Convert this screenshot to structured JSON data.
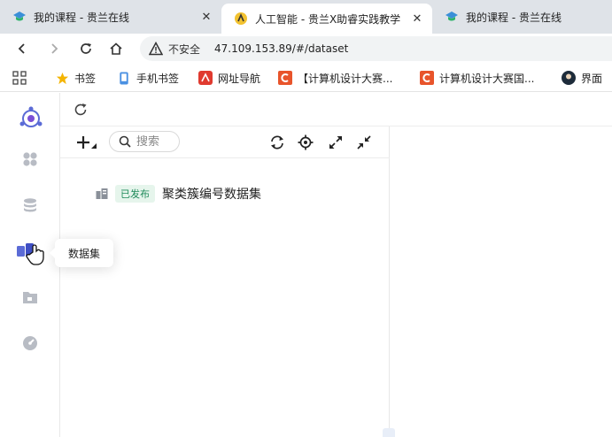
{
  "browser": {
    "tabs": [
      {
        "title": "我的课程 - 贵兰在线",
        "icon": "graduation-cap-icon",
        "active": false
      },
      {
        "title": "人工智能 - 贵兰X助睿实践教学",
        "icon": "ai-logo-icon",
        "active": true
      },
      {
        "title": "我的课程 - 贵兰在线",
        "icon": "graduation-cap-icon",
        "active": false
      }
    ],
    "close_glyph": "✕",
    "address": {
      "security_label": "不安全",
      "url": "47.109.153.89/#/dataset"
    },
    "bookmarks": [
      {
        "label": "书签",
        "icon": "star-icon"
      },
      {
        "label": "手机书签",
        "icon": "phone-icon"
      },
      {
        "label": "网址导航",
        "icon": "nav-logo-icon"
      },
      {
        "label": "【计算机设计大赛...",
        "icon": "c-logo-icon"
      },
      {
        "label": "计算机设计大赛国...",
        "icon": "c-logo-icon"
      },
      {
        "label": "界面",
        "icon": "avatar-icon"
      }
    ]
  },
  "app": {
    "sidebar": {
      "items": [
        {
          "name": "apps",
          "icon": "grid-icon"
        },
        {
          "name": "database",
          "icon": "database-icon"
        },
        {
          "name": "dataset",
          "icon": "dataset-icon",
          "active": true
        },
        {
          "name": "folder",
          "icon": "folder-icon"
        },
        {
          "name": "dashboard",
          "icon": "gauge-icon"
        }
      ],
      "tooltip": "数据集"
    },
    "panel": {
      "search_placeholder": "搜索",
      "tree": [
        {
          "status": "已发布",
          "name": "聚类簇编号数据集"
        }
      ]
    }
  },
  "colors": {
    "accent": "#5b6bd6",
    "published_text": "#1f8a5a",
    "published_bg": "#e6f5ec",
    "rail_icon": "#b8bcc4"
  }
}
